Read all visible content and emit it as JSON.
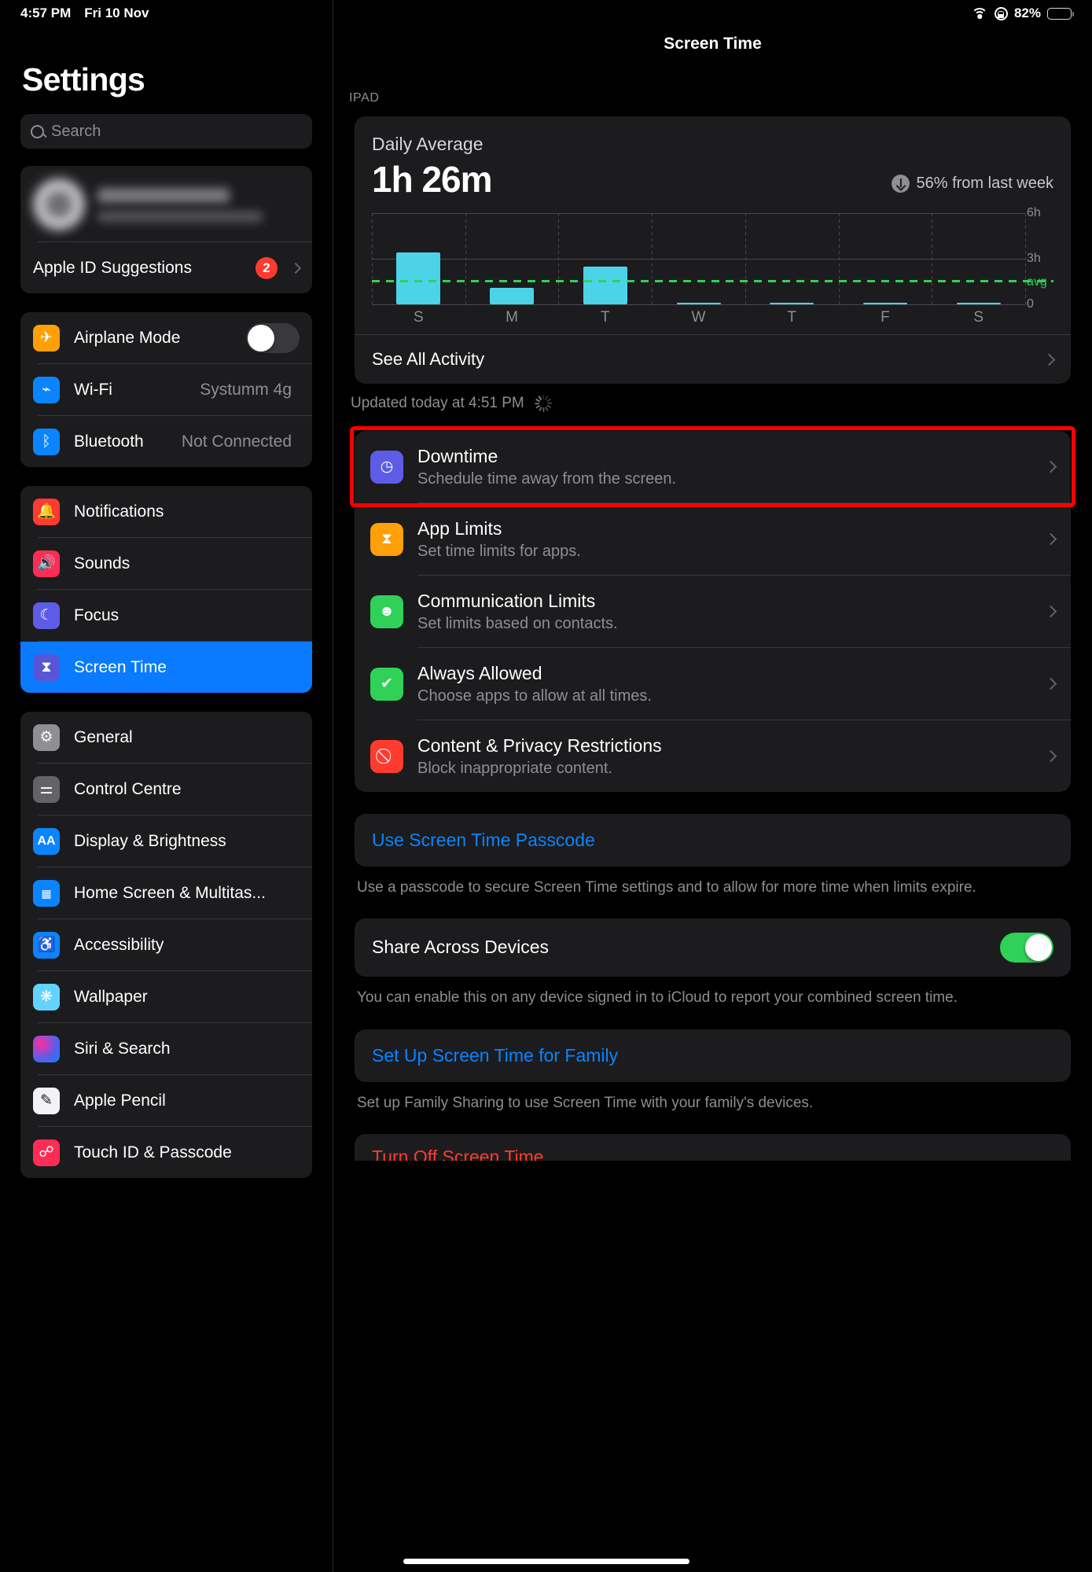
{
  "status_bar": {
    "time": "4:57 PM",
    "date": "Fri 10 Nov",
    "battery_percent": "82%",
    "wifi_icon": "wifi-icon",
    "rotation_lock_icon": "rotation-lock-icon"
  },
  "sidebar": {
    "title": "Settings",
    "search_placeholder": "Search",
    "apple_id_suggestions": {
      "label": "Apple ID Suggestions",
      "badge": "2"
    },
    "connectivity": [
      {
        "label": "Airplane Mode",
        "icon": "airplane-icon",
        "icon_color": "#ff9f0a",
        "control": "toggle",
        "value": "off"
      },
      {
        "label": "Wi-Fi",
        "icon": "wifi-icon",
        "icon_color": "#0a84ff",
        "control": "value",
        "value": "Systumm 4g"
      },
      {
        "label": "Bluetooth",
        "icon": "bluetooth-icon",
        "icon_color": "#0a84ff",
        "control": "value",
        "value": "Not Connected"
      }
    ],
    "alerts": [
      {
        "label": "Notifications",
        "icon": "bell-icon",
        "icon_color": "#ff3b30",
        "selected": false
      },
      {
        "label": "Sounds",
        "icon": "speaker-icon",
        "icon_color": "#ff2d55",
        "selected": false
      },
      {
        "label": "Focus",
        "icon": "moon-icon",
        "icon_color": "#5e5ce6",
        "selected": false
      },
      {
        "label": "Screen Time",
        "icon": "hourglass-icon",
        "icon_color": "#5e5ce6",
        "selected": true
      }
    ],
    "system": [
      {
        "label": "General",
        "icon": "gear-icon",
        "icon_color": "#8e8e93"
      },
      {
        "label": "Control Centre",
        "icon": "sliders-icon",
        "icon_color": "#8e8e93"
      },
      {
        "label": "Display & Brightness",
        "icon": "text-size-icon",
        "icon_color": "#0a84ff"
      },
      {
        "label": "Home Screen & Multitas...",
        "icon": "home-screen-icon",
        "icon_color": "#0a84ff"
      },
      {
        "label": "Accessibility",
        "icon": "accessibility-icon",
        "icon_color": "#0a84ff"
      },
      {
        "label": "Wallpaper",
        "icon": "wallpaper-icon",
        "icon_color": "#64d2ff"
      },
      {
        "label": "Siri & Search",
        "icon": "siri-icon",
        "icon_color": "#ff2d9b"
      },
      {
        "label": "Apple Pencil",
        "icon": "pencil-icon",
        "icon_color": "#f2f2f7"
      },
      {
        "label": "Touch ID & Passcode",
        "icon": "fingerprint-icon",
        "icon_color": "#ff2d55"
      }
    ]
  },
  "main": {
    "nav_title": "Screen Time",
    "device_section_header": "IPAD",
    "daily_average_label": "Daily Average",
    "daily_average_value": "1h 26m",
    "trend_text": "56% from last week",
    "trend_icon": "arrow-down-icon",
    "see_all_activity": "See All Activity",
    "updated_text": "Updated today at 4:51 PM",
    "settings_rows": [
      {
        "title": "Downtime",
        "subtitle": "Schedule time away from the screen.",
        "icon": "downtime-icon",
        "icon_color": "#5e5ce6",
        "highlighted": true
      },
      {
        "title": "App Limits",
        "subtitle": "Set time limits for apps.",
        "icon": "hourglass-icon",
        "icon_color": "#ff9f0a",
        "highlighted": false
      },
      {
        "title": "Communication Limits",
        "subtitle": "Set limits based on contacts.",
        "icon": "person-icon",
        "icon_color": "#30d158",
        "highlighted": false
      },
      {
        "title": "Always Allowed",
        "subtitle": "Choose apps to allow at all times.",
        "icon": "checkmark-badge-icon",
        "icon_color": "#30d158",
        "highlighted": false
      },
      {
        "title": "Content & Privacy Restrictions",
        "subtitle": "Block inappropriate content.",
        "icon": "prohibited-icon",
        "icon_color": "#ff3b30",
        "highlighted": false
      }
    ],
    "passcode_link": "Use Screen Time Passcode",
    "passcode_footnote": "Use a passcode to secure Screen Time settings and to allow for more time when limits expire.",
    "share_toggle_label": "Share Across Devices",
    "share_toggle_value": "on",
    "share_footnote": "You can enable this on any device signed in to iCloud to report your combined screen time.",
    "family_link": "Set Up Screen Time for Family",
    "family_footnote": "Set up Family Sharing to use Screen Time with your family's devices.",
    "turn_off_link": "Turn Off Screen Time"
  },
  "chart_data": {
    "type": "bar",
    "title": "Daily Average",
    "categories": [
      "S",
      "M",
      "T",
      "W",
      "T",
      "F",
      "S"
    ],
    "values": [
      3.4,
      1.1,
      2.5,
      0.05,
      0.05,
      0.05,
      0.05
    ],
    "ylabel": "",
    "xlabel": "",
    "ylim": [
      0,
      6
    ],
    "ytick_labels": [
      "6h",
      "3h",
      "avg",
      "0"
    ],
    "average_line": 1.43,
    "average_line_label": "avg",
    "average_line_color": "#30d158",
    "bar_color": "#4cd3e8",
    "grid": true,
    "legend": "none"
  }
}
